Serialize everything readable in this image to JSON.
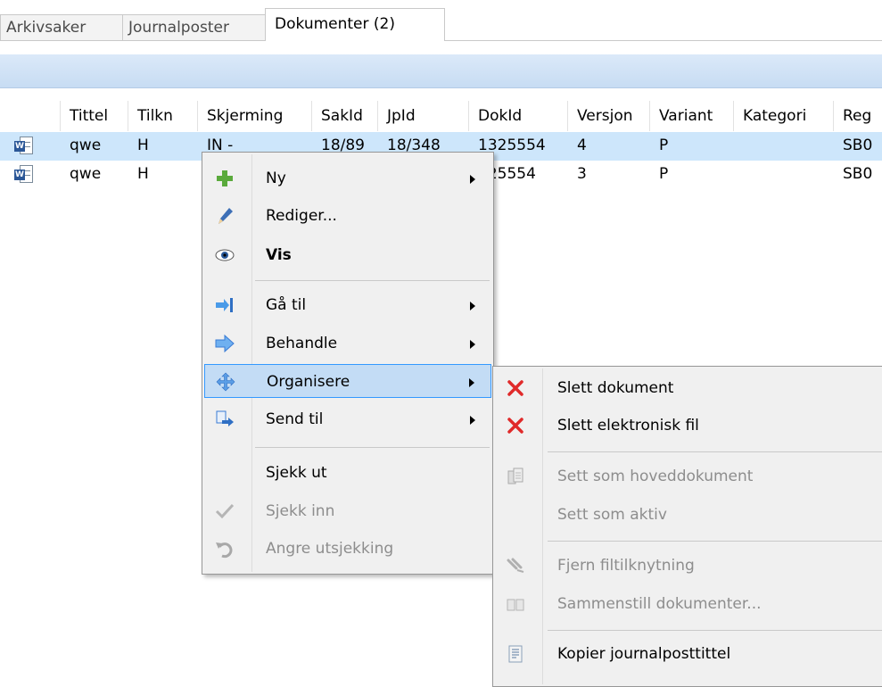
{
  "tabs": [
    {
      "label": "Arkivsaker"
    },
    {
      "label": "Journalposter"
    },
    {
      "label": "Dokumenter (2)"
    }
  ],
  "grid": {
    "headers": [
      "Tittel",
      "Tilkn",
      "Skjerming",
      "SakId",
      "JpId",
      "DokId",
      "Versjon",
      "Variant",
      "Kategori",
      "Reg"
    ],
    "rows": [
      {
        "tittel": "qwe",
        "tilkn": "H",
        "skjerming": "IN -",
        "sakid": "18/89",
        "jpid": "18/348",
        "dokid": "1325554",
        "versjon": "4",
        "variant": "P",
        "kategori": "",
        "reg": "SB0"
      },
      {
        "tittel": "qwe",
        "tilkn": "H",
        "skjerming": "",
        "sakid": "",
        "jpid": "",
        "dokid": "325554",
        "versjon": "3",
        "variant": "P",
        "kategori": "",
        "reg": "SB0"
      }
    ]
  },
  "context_menu": {
    "items": [
      {
        "label": "Ny"
      },
      {
        "label": "Rediger..."
      },
      {
        "label": "Vis"
      },
      {
        "label": "Gå til"
      },
      {
        "label": "Behandle"
      },
      {
        "label": "Organisere"
      },
      {
        "label": "Send til"
      },
      {
        "label": "Sjekk ut"
      },
      {
        "label": "Sjekk inn"
      },
      {
        "label": "Angre utsjekking"
      }
    ]
  },
  "submenu": {
    "items": [
      {
        "label": "Slett dokument"
      },
      {
        "label": "Slett elektronisk fil"
      },
      {
        "label": "Sett som hoveddokument"
      },
      {
        "label": "Sett som aktiv"
      },
      {
        "label": "Fjern filtilknytning"
      },
      {
        "label": "Sammenstill dokumenter..."
      },
      {
        "label": "Kopier journalposttittel"
      }
    ]
  },
  "colors": {
    "selection": "#cde6fb",
    "menu_hot": "#c3dcf5",
    "menu_hot_border": "#3399ff",
    "disabled_text": "#8d8d8d",
    "band_top": "#dbe9f9",
    "band_bottom": "#c7dcf3"
  }
}
